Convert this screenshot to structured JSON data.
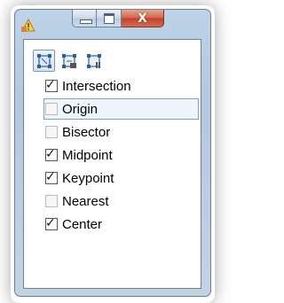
{
  "window": {
    "close_glyph": "X",
    "accent": "#b9cde2",
    "close_color": "#c94a32"
  },
  "toolbar": {
    "buttons": [
      {
        "name": "snap-all-icon",
        "active": true
      },
      {
        "name": "snap-partial-icon",
        "active": false
      },
      {
        "name": "snap-edge-icon",
        "active": false
      }
    ]
  },
  "snaps": {
    "items": [
      {
        "label": "Intersection",
        "checked": true
      },
      {
        "label": "Origin",
        "checked": false,
        "selected": true
      },
      {
        "label": "Bisector",
        "checked": false
      },
      {
        "label": "Midpoint",
        "checked": true
      },
      {
        "label": "Keypoint",
        "checked": true
      },
      {
        "label": "Nearest",
        "checked": false
      },
      {
        "label": "Center",
        "checked": true
      }
    ]
  }
}
